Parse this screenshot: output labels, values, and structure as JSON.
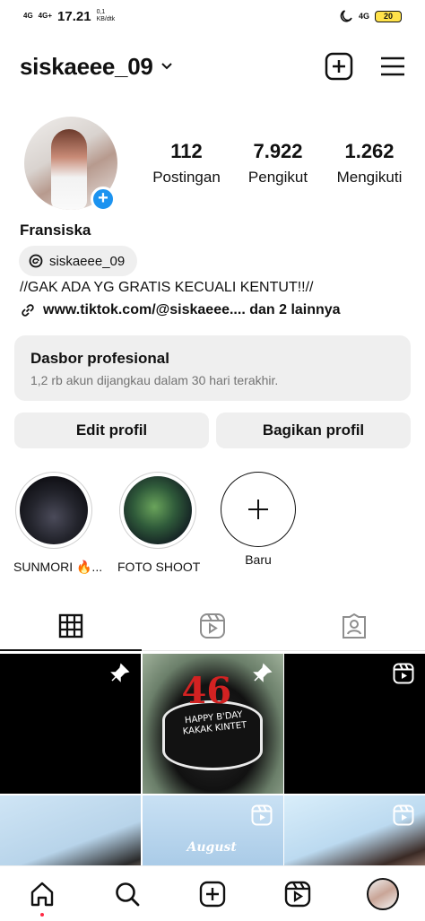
{
  "status_bar": {
    "net1": "4G",
    "net2": "4G+",
    "time": "17.21",
    "speed_value": "0,1",
    "speed_unit": "KB/dtk",
    "net3": "4G",
    "battery": "20"
  },
  "header": {
    "username": "siskaeee_09"
  },
  "profile": {
    "stats": [
      {
        "value": "112",
        "label": "Postingan"
      },
      {
        "value": "7.922",
        "label": "Pengikut"
      },
      {
        "value": "1.262",
        "label": "Mengikuti"
      }
    ],
    "full_name": "Fransiska",
    "threads_handle": "siskaeee_09",
    "bio": "//GAK ADA YG GRATIS KECUALI KENTUT!!//",
    "link": "www.tiktok.com/@siskaeee.... dan 2 lainnya"
  },
  "dashboard": {
    "title": "Dasbor profesional",
    "subtitle": "1,2 rb akun dijangkau dalam 30 hari terakhir."
  },
  "buttons": {
    "edit": "Edit profil",
    "share": "Bagikan profil"
  },
  "highlights": [
    {
      "label": "SUNMORI 🔥..."
    },
    {
      "label": "FOTO SHOOT"
    },
    {
      "label": "Baru"
    }
  ],
  "grid": {
    "cake_number": "46",
    "cake_text": "HAPPY B'DAY KAKAK KINTET",
    "sky_text": "August"
  },
  "colors": {
    "accent": "#1c93f0",
    "button_bg": "#efefef",
    "notification_dot": "#ff2a44"
  },
  "icons": {
    "header": [
      "chevron-down-icon",
      "create-icon",
      "menu-icon"
    ],
    "tabs": [
      "grid-icon",
      "reels-icon",
      "tagged-icon"
    ],
    "nav": [
      "home-icon",
      "search-icon",
      "create-icon",
      "reels-icon",
      "profile-avatar"
    ]
  }
}
